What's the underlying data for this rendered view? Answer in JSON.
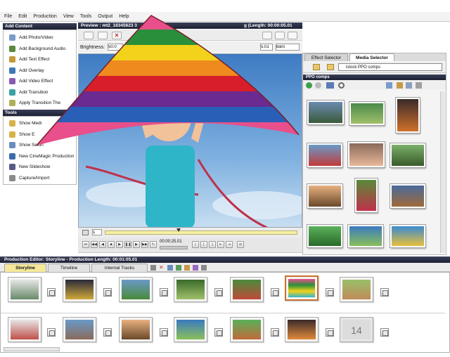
{
  "menu": [
    "File",
    "Edit",
    "Production",
    "View",
    "Tools",
    "Output",
    "Help"
  ],
  "add_content": {
    "title": "Add Content",
    "items": [
      "Add Photo/Video",
      "Add Background Audio",
      "Add Text Effect",
      "Add Overlay",
      "Add Video Effect",
      "Add Transition",
      "Apply Transition The"
    ]
  },
  "tools": {
    "title": "Tools",
    "items": [
      "Show Medi",
      "Show E",
      "Show Settin",
      "New CineMagic Production",
      "New Slideshow",
      "Capture/Import"
    ]
  },
  "preview": {
    "title": "Preview : mt2_18345623 3",
    "title_right": "g (Length: 00:00:05.01",
    "brightness_label": "Brightness:",
    "brightness_value": "50.0",
    "value2": "5.01",
    "mode": "Bars",
    "frame_value": "1",
    "timecode": "00:00:25.01"
  },
  "right_panel": {
    "tabs": [
      "Effect Selector",
      "Media Selector"
    ],
    "folder": "istock PPO comps",
    "section": "PPO comps"
  },
  "production": {
    "title": "Production Editor: Storyline - Production Length: 00:01:05.01",
    "tabs": [
      "Storyline",
      "Timeline",
      "Internal Tracks"
    ],
    "placeholder_number": "14"
  },
  "colors": {
    "header": "#2a2f45",
    "panel_bg": "#f4f4f4",
    "sky": "#5f9bd6",
    "accent_yellow": "#f7f0a2"
  }
}
